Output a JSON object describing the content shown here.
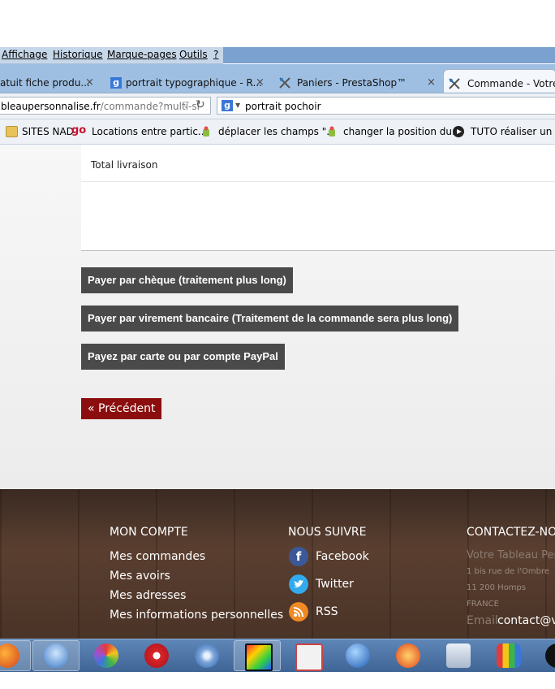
{
  "menubar": {
    "items": [
      "Affichage",
      "Historique",
      "Marque-pages",
      "Outils",
      "?"
    ]
  },
  "tabs": [
    {
      "label": "atuit fiche produ...",
      "close": "×"
    },
    {
      "label": "portrait typographique - R...",
      "close": "×"
    },
    {
      "label": "Paniers - PrestaShop™",
      "close": "×"
    },
    {
      "label": "Commande - Votre T",
      "close": ""
    }
  ],
  "navbar": {
    "url_host": "bleaupersonnalise.fr",
    "url_path": "/commande?multi-sl",
    "search_value": "portrait pochoir",
    "search_engine_icon": "g"
  },
  "bookmarks": [
    {
      "label": "SITES NAD",
      "icon": "folder-icon"
    },
    {
      "label": "Locations entre partic...",
      "icon": "go-icon",
      "icon_text": "go"
    },
    {
      "label": "déplacer les champs \"...",
      "icon": "android-icon"
    },
    {
      "label": "changer la position du...",
      "icon": "android-icon"
    },
    {
      "label": "TUTO réaliser un po",
      "icon": "play-icon"
    }
  ],
  "order": {
    "total_label": "Total livraison"
  },
  "payment_buttons": [
    "Payer par chèque (traitement plus long)",
    "Payer par virement bancaire (Traitement de la commande sera plus long)",
    "Payez par carte ou par compte PayPal"
  ],
  "previous_button": "« Précédent",
  "footer": {
    "account": {
      "title": "MON COMPTE",
      "links": [
        "Mes commandes",
        "Mes avoirs",
        "Mes adresses",
        "Mes informations personnelles"
      ]
    },
    "follow": {
      "title": "NOUS SUIVRE",
      "links": [
        "Facebook",
        "Twitter",
        "RSS"
      ]
    },
    "contact": {
      "title": "CONTACTEZ-NO",
      "company": "Votre Tableau Pers",
      "address_lines": [
        "1 bis rue de l'Ombre",
        "11 200 Homps",
        "FRANCE"
      ],
      "email_label": "Email",
      "email": "contact@vo"
    }
  },
  "colors": {
    "pay_button": "#4a4a4a",
    "previous_button": "#8b0d0d",
    "footer_wood": "#4a3327",
    "taskbar": "#4f77a8"
  },
  "taskbar_icons": [
    "firefox-icon",
    "thunderbird-icon",
    "picasa-icon",
    "acrobat-icon",
    "dvd-burner-icon",
    "video-editor-icon",
    "photo-frame-icon",
    "google-earth-icon",
    "ccleaner-icon",
    "installer-icon",
    "avg-icon",
    "dark-app-icon"
  ]
}
